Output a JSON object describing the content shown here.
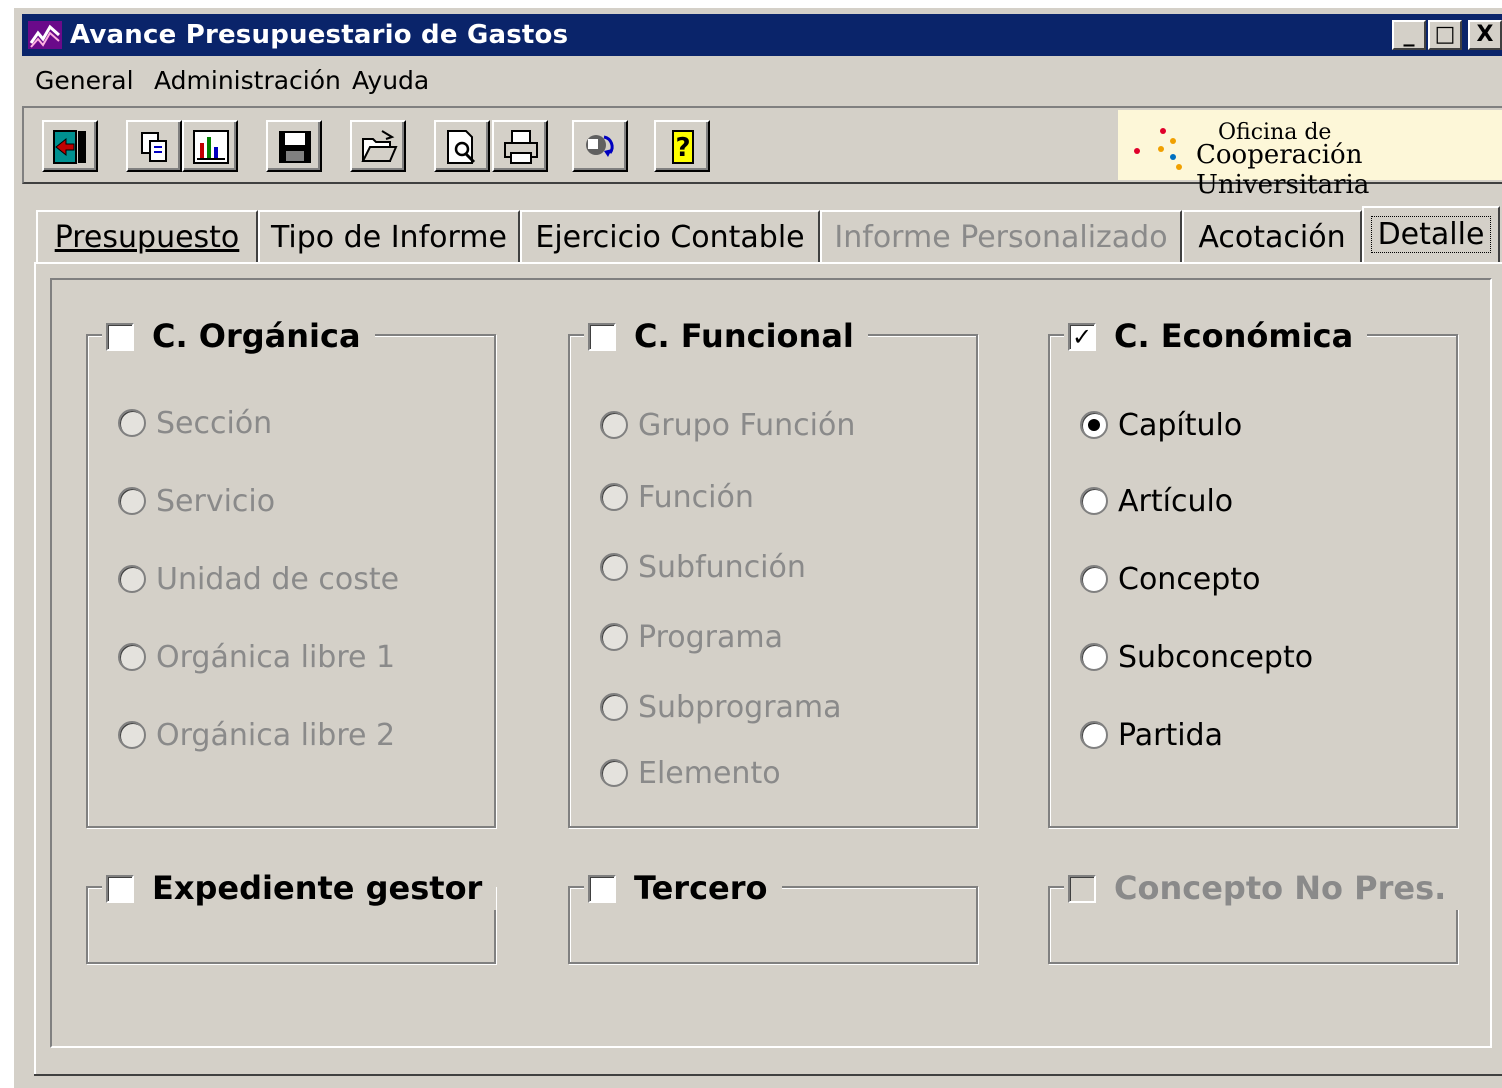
{
  "window": {
    "title": "Avance Presupuestario de Gastos",
    "controls": [
      "_",
      "□",
      "X"
    ]
  },
  "menu": [
    "General",
    "Administración",
    "Ayuda"
  ],
  "toolbar": {
    "buttons": [
      "exit-icon",
      "copy-icon",
      "chart-icon",
      "save-icon",
      "open-folder-icon",
      "print-preview-icon",
      "printer-icon",
      "refresh-icon",
      "help-icon"
    ]
  },
  "logo": {
    "line1": "Oficina de",
    "line2": "Cooperación Universitaria"
  },
  "tabs": [
    {
      "label": "Presupuesto",
      "state": "normal"
    },
    {
      "label": "Tipo de Informe",
      "state": "normal"
    },
    {
      "label": "Ejercicio Contable",
      "state": "normal"
    },
    {
      "label": "Informe Personalizado",
      "state": "disabled"
    },
    {
      "label": "Acotación",
      "state": "normal"
    },
    {
      "label": "Detalle",
      "state": "active"
    }
  ],
  "groups": {
    "organica": {
      "title": "C. Orgánica",
      "checked": false,
      "options": [
        "Sección",
        "Servicio",
        "Unidad de coste",
        "Orgánica libre 1",
        "Orgánica libre 2"
      ]
    },
    "funcional": {
      "title": "C. Funcional",
      "checked": false,
      "options": [
        "Grupo Función",
        "Función",
        "Subfunción",
        "Programa",
        "Subprograma",
        "Elemento"
      ]
    },
    "economica": {
      "title": "C. Económica",
      "checked": true,
      "options": [
        "Capítulo",
        "Artículo",
        "Concepto",
        "Subconcepto",
        "Partida"
      ],
      "selected": "Capítulo"
    },
    "expediente": {
      "title": "Expediente gestor",
      "checked": false
    },
    "tercero": {
      "title": "Tercero",
      "checked": false
    },
    "concepto_no_pres": {
      "title": "Concepto No Pres.",
      "checked": false,
      "disabled": true
    }
  },
  "colors": {
    "face": "#d4d0c8",
    "titlebar": "#0a246a",
    "disabled_text": "#8a8a8a",
    "logo_bg": "#fdf7d8"
  }
}
